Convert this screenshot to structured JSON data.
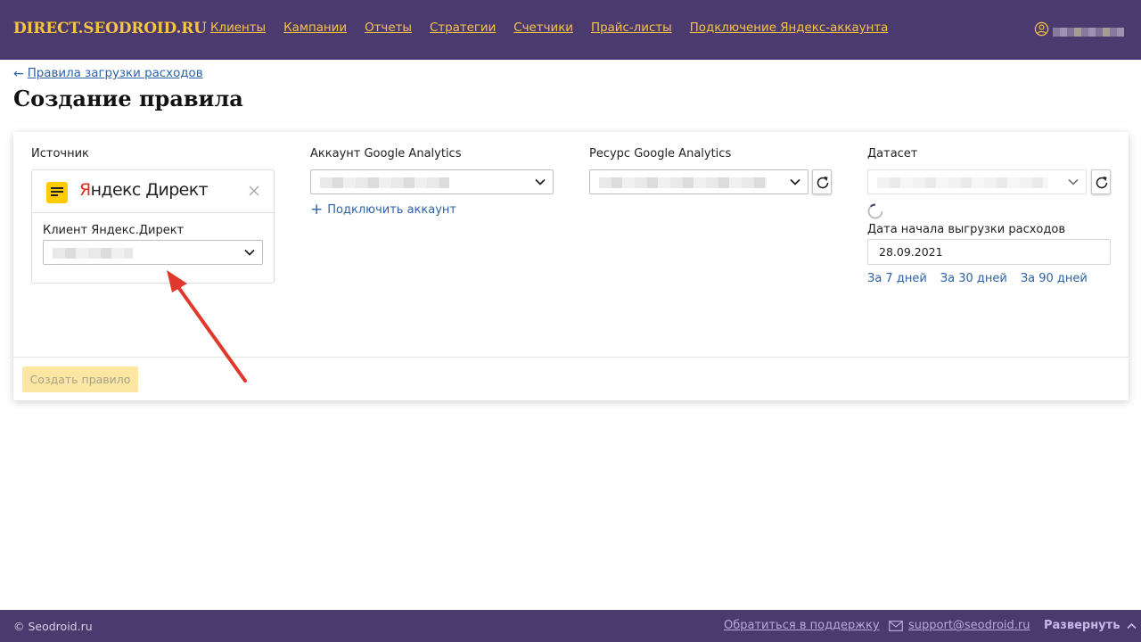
{
  "header": {
    "brand": "DIRECT.SEODROID.RU",
    "nav": [
      "Клиенты",
      "Кампании",
      "Отчеты",
      "Стратегии",
      "Счетчики",
      "Прайс-листы",
      "Подключение Яндекс-аккаунта"
    ]
  },
  "back_link": "Правила загрузки расходов",
  "page_title": "Создание правила",
  "form": {
    "source": {
      "label": "Источник",
      "logo_text_y": "Я",
      "logo_text_rest": "ндекс Директ",
      "client_label": "Клиент Яндекс.Директ"
    },
    "ga_account": {
      "label": "Аккаунт Google Analytics",
      "connect_label": "Подключить аккаунт"
    },
    "ga_resource": {
      "label": "Ресурс Google Analytics"
    },
    "dataset": {
      "label": "Датасет",
      "start_date_label": "Дата начала выгрузки расходов",
      "start_date_value": "28.09.2021",
      "quick_ranges": [
        "За 7 дней",
        "За 30 дней",
        "За 90 дней"
      ]
    },
    "submit_label": "Создать правило"
  },
  "footer": {
    "copyright": "© Seodroid.ru",
    "support_link": "Обратиться в поддержку",
    "email": "support@seodroid.ru",
    "expand_label": "Развернуть"
  },
  "colors": {
    "header_bg": "#4b3a6e",
    "brand_accent": "#f6c344",
    "link": "#2c62a6",
    "button_disabled_bg": "#fbe7a2",
    "annotation_arrow": "#e0392b"
  }
}
